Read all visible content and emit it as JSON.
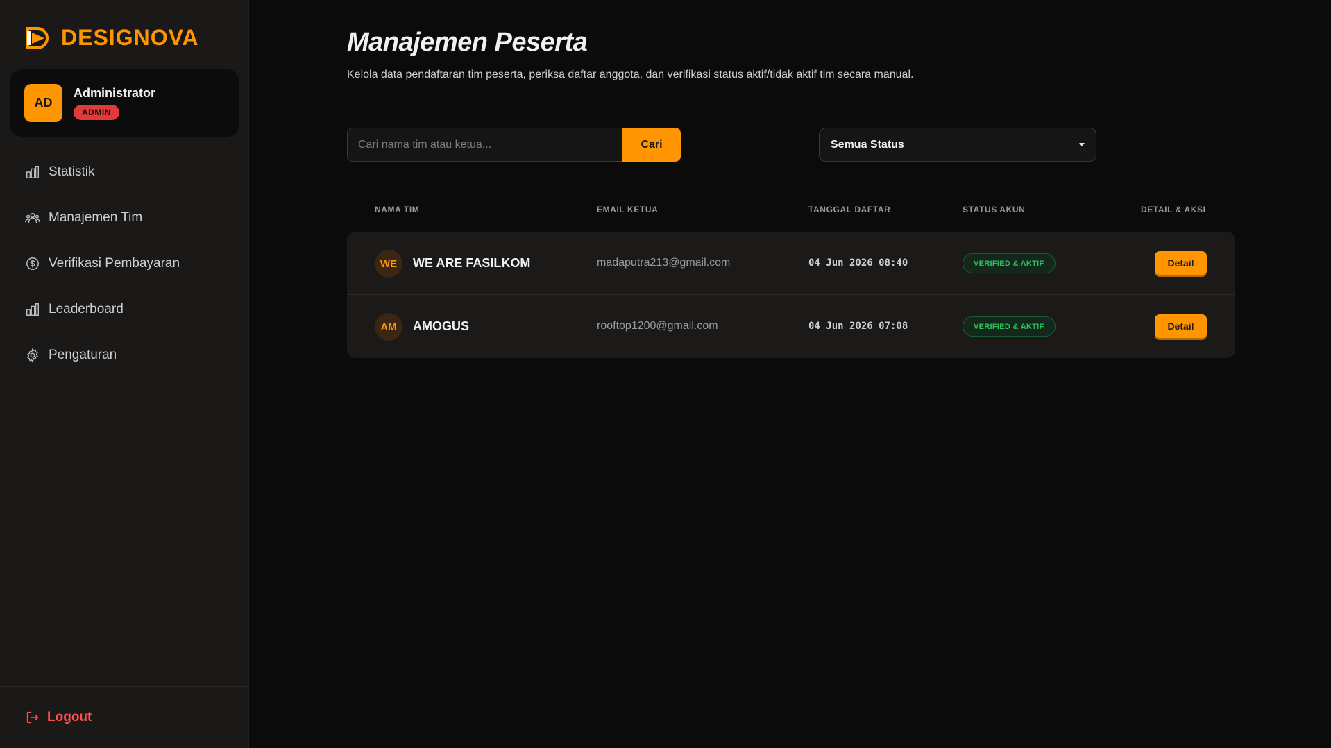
{
  "brand": {
    "name": "DESIGNOVA"
  },
  "profile": {
    "initials": "AD",
    "name": "Administrator",
    "role": "ADMIN"
  },
  "nav": [
    {
      "label": "Statistik",
      "icon": "bar-chart-icon"
    },
    {
      "label": "Manajemen Tim",
      "icon": "users-icon"
    },
    {
      "label": "Verifikasi Pembayaran",
      "icon": "dollar-circle-icon"
    },
    {
      "label": "Leaderboard",
      "icon": "bar-chart-icon"
    },
    {
      "label": "Pengaturan",
      "icon": "gear-icon"
    }
  ],
  "logout_label": "Logout",
  "page": {
    "title": "Manajemen Peserta",
    "description": "Kelola data pendaftaran tim peserta, periksa daftar anggota, dan verifikasi status aktif/tidak aktif tim secara manual."
  },
  "search": {
    "placeholder": "Cari nama tim atau ketua...",
    "value": "",
    "button_label": "Cari"
  },
  "filter": {
    "selected": "Semua Status"
  },
  "table": {
    "headers": [
      "NAMA TIM",
      "EMAIL KETUA",
      "TANGGAL DAFTAR",
      "STATUS AKUN",
      "DETAIL & AKSI"
    ],
    "rows": [
      {
        "initials": "WE",
        "team": "WE ARE FASILKOM",
        "email": "madaputra213@gmail.com",
        "date": "04 Jun 2026 08:40",
        "status": "VERIFIED & AKTIF",
        "action": "Detail"
      },
      {
        "initials": "AM",
        "team": "AMOGUS",
        "email": "rooftop1200@gmail.com",
        "date": "04 Jun 2026 07:08",
        "status": "VERIFIED & AKTIF",
        "action": "Detail"
      }
    ]
  },
  "colors": {
    "accent": "#ff9500",
    "danger": "#ff4f4f",
    "success": "#2ec25c"
  }
}
